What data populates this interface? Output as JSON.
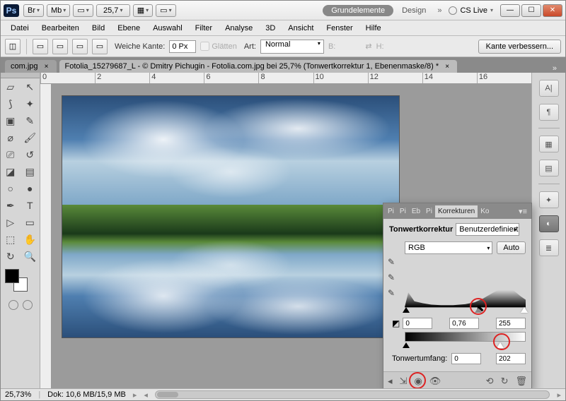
{
  "app": {
    "badge": "Ps"
  },
  "titlebar": {
    "icon1": "Br",
    "icon2": "Mb",
    "zoom": "25,7",
    "workspace_active": "Grundelemente",
    "workspace_other": "Design",
    "cslive": "CS Live"
  },
  "menu": {
    "datei": "Datei",
    "bearbeiten": "Bearbeiten",
    "bild": "Bild",
    "ebene": "Ebene",
    "auswahl": "Auswahl",
    "filter": "Filter",
    "analyse": "Analyse",
    "dreid": "3D",
    "ansicht": "Ansicht",
    "fenster": "Fenster",
    "hilfe": "Hilfe"
  },
  "options": {
    "feather_label": "Weiche Kante:",
    "feather_value": "0 Px",
    "antialias_label": "Glätten",
    "mode_label": "Art:",
    "mode_value": "Normal",
    "b_label": "B:",
    "h_label": "H:",
    "refine": "Kante verbessern..."
  },
  "tabs": {
    "inactive": "com.jpg",
    "active": "Fotolia_15279687_L - © Dmitry Pichugin - Fotolia.com.jpg bei 25,7% (Tonwertkorrektur 1, Ebenenmaske/8) *"
  },
  "ruler_marks": [
    "0",
    "2",
    "4",
    "6",
    "8",
    "10",
    "12",
    "14",
    "16"
  ],
  "panel": {
    "tabs": {
      "t1": "Pi",
      "t2": "Pi",
      "t3": "Eb",
      "t4": "Pi",
      "active": "Korrekturen",
      "t6": "Ko"
    },
    "title": "Tonwertkorrektur",
    "preset": "Benutzerdefiniert",
    "channel": "RGB",
    "auto": "Auto",
    "input_black": "0",
    "input_gamma": "0,76",
    "input_white": "255",
    "output_label": "Tonwertumfang:",
    "output_black": "0",
    "output_white": "202"
  },
  "status": {
    "zoom": "25,73%",
    "doc": "Dok: 10,6 MB/15,9 MB"
  }
}
